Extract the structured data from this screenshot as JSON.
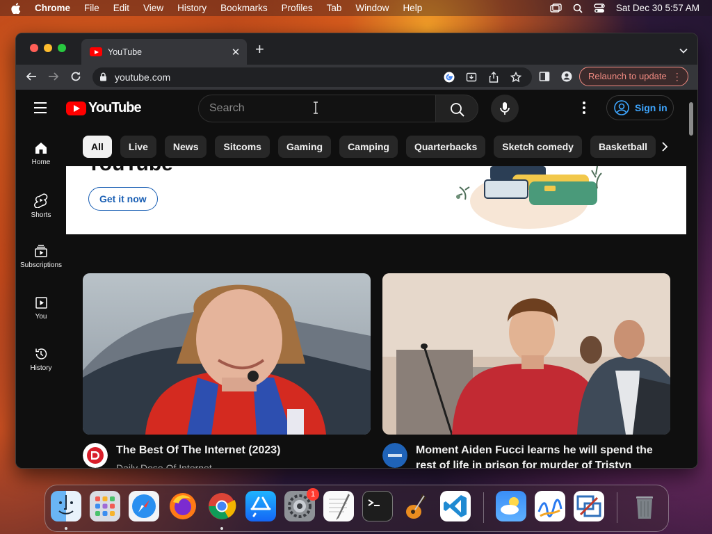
{
  "menubar": {
    "app_name": "Chrome",
    "items": [
      "File",
      "Edit",
      "View",
      "History",
      "Bookmarks",
      "Profiles",
      "Tab",
      "Window",
      "Help"
    ],
    "datetime": "Sat Dec 30  5:57 AM"
  },
  "browser": {
    "tab_title": "YouTube",
    "url": "youtube.com",
    "relaunch_label": "Relaunch to update"
  },
  "youtube": {
    "search_placeholder": "Search",
    "sign_in": "Sign in",
    "chips": [
      "All",
      "Live",
      "News",
      "Sitcoms",
      "Gaming",
      "Camping",
      "Quarterbacks",
      "Sketch comedy",
      "Basketball"
    ],
    "sidebar": [
      {
        "label": "Home",
        "icon": "home-icon"
      },
      {
        "label": "Shorts",
        "icon": "shorts-icon"
      },
      {
        "label": "Subscriptions",
        "icon": "subscriptions-icon"
      },
      {
        "label": "You",
        "icon": "you-icon"
      },
      {
        "label": "History",
        "icon": "history-icon"
      }
    ],
    "banner": {
      "title_fragment": "YouTube",
      "cta": "Get it now"
    },
    "videos": [
      {
        "title": "The Best Of The Internet (2023)",
        "channel": "Daily Dose Of Internet"
      },
      {
        "title": "Moment Aiden Fucci learns he will spend the rest of life in prison for murder of Tristyn Bailey",
        "channel": ""
      }
    ]
  },
  "dock": {
    "apps": [
      "Finder",
      "Launchpad",
      "Safari",
      "Firefox",
      "Chrome",
      "App Store",
      "System Settings",
      "TextEdit",
      "Terminal",
      "GarageBand",
      "Visual Studio Code",
      "Weather",
      "Freeform",
      "Remote Desktop",
      "Trash"
    ],
    "settings_badge": "1"
  }
}
